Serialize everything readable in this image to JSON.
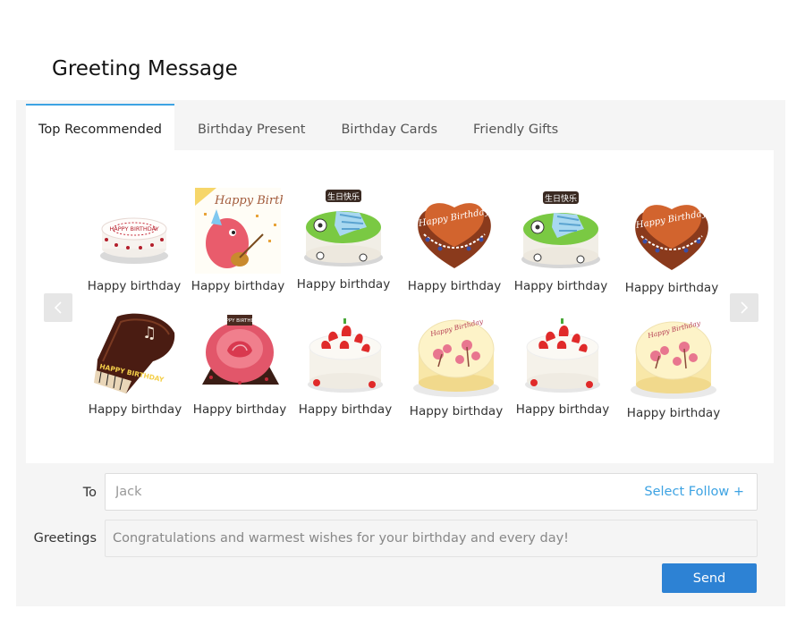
{
  "page": {
    "title": "Greeting Message"
  },
  "tabs": [
    {
      "label": "Top Recommended",
      "active": true
    },
    {
      "label": "Birthday Present",
      "active": false
    },
    {
      "label": "Birthday Cards",
      "active": false
    },
    {
      "label": "Friendly Gifts",
      "active": false
    }
  ],
  "gallery": {
    "items": [
      {
        "caption": "Happy birthday",
        "image": "white-round-cake-icon",
        "image_text": "HAPPY BIRTHDAY"
      },
      {
        "caption": "Happy birthday",
        "image": "birthday-card-icon",
        "image_text": "Happy Birthday"
      },
      {
        "caption": "Happy birthday",
        "image": "football-cake-icon",
        "image_text": "生日快乐"
      },
      {
        "caption": "Happy birthday",
        "image": "heart-chocolate-cake-icon",
        "image_text": "Happy Birthday"
      },
      {
        "caption": "Happy birthday",
        "image": "football-cake-icon",
        "image_text": "生日快乐"
      },
      {
        "caption": "Happy birthday",
        "image": "heart-chocolate-cake-icon",
        "image_text": "Happy Birthday"
      },
      {
        "caption": "Happy birthday",
        "image": "piano-cake-icon",
        "image_text": "HAPPY BIRTHDAY"
      },
      {
        "caption": "Happy birthday",
        "image": "rose-cake-icon",
        "image_text": "HAPPY BIRTHDAY"
      },
      {
        "caption": "Happy birthday",
        "image": "strawberry-cake-icon",
        "image_text": ""
      },
      {
        "caption": "Happy birthday",
        "image": "flower-cake-icon",
        "image_text": "Happy Birthday"
      },
      {
        "caption": "Happy birthday",
        "image": "strawberry-cake-icon",
        "image_text": ""
      },
      {
        "caption": "Happy birthday",
        "image": "flower-cake-icon",
        "image_text": "Happy Birthday"
      }
    ]
  },
  "form": {
    "to_label": "To",
    "to_value": "Jack",
    "select_follow": "Select Follow +",
    "greetings_label": "Greetings",
    "greetings_value": "Congratulations and warmest wishes for your birthday and every day!",
    "send_label": "Send"
  },
  "colors": {
    "accent": "#3da3e3",
    "button": "#2d82d4"
  }
}
